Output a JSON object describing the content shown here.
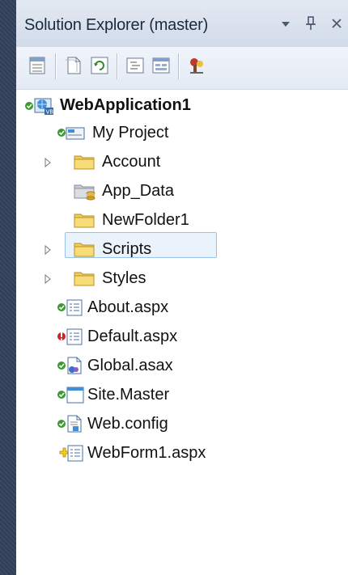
{
  "window": {
    "title": "Solution Explorer (master)",
    "controls": {
      "dropdown_icon": "dropdown-arrow",
      "pin_icon": "pin",
      "close_icon": "close"
    }
  },
  "toolbar": {
    "buttons": [
      {
        "name": "properties-icon"
      },
      {
        "name": "show-all-files-icon"
      },
      {
        "name": "refresh-icon"
      },
      {
        "name": "view-code-icon"
      },
      {
        "name": "view-designer-icon"
      },
      {
        "name": "copy-website-icon"
      }
    ]
  },
  "tree": {
    "root": {
      "label": "WebApplication1",
      "status": "checked-in"
    },
    "items": [
      {
        "label": "My Project",
        "type": "project-properties",
        "status": "checked-in",
        "expandable": false
      },
      {
        "label": "Account",
        "type": "folder",
        "status": "",
        "expandable": true
      },
      {
        "label": "App_Data",
        "type": "data-folder",
        "status": "",
        "expandable": false
      },
      {
        "label": "NewFolder1",
        "type": "folder",
        "status": "",
        "expandable": false
      },
      {
        "label": "Scripts",
        "type": "folder",
        "status": "",
        "expandable": true
      },
      {
        "label": "Styles",
        "type": "folder",
        "status": "",
        "expandable": true
      },
      {
        "label": "About.aspx",
        "type": "aspx",
        "status": "checked-in",
        "expandable": false
      },
      {
        "label": "Default.aspx",
        "type": "aspx",
        "status": "modified",
        "expandable": false,
        "selected": true
      },
      {
        "label": "Global.asax",
        "type": "asax",
        "status": "checked-in",
        "expandable": false
      },
      {
        "label": "Site.Master",
        "type": "master",
        "status": "checked-in",
        "expandable": false
      },
      {
        "label": "Web.config",
        "type": "config",
        "status": "checked-in",
        "expandable": false
      },
      {
        "label": "WebForm1.aspx",
        "type": "aspx",
        "status": "added",
        "expandable": false
      }
    ]
  },
  "colors": {
    "checked_in": "#3a9b2f",
    "modified": "#cc2222",
    "added": "#e0b000",
    "folder": "#f2cf58",
    "selection_border": "#99c2ea"
  }
}
